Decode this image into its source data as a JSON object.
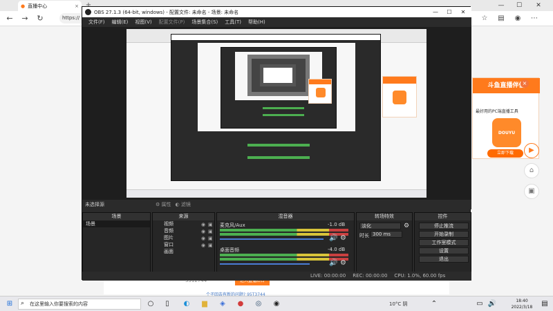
{
  "browser": {
    "tab_title": "直播中心",
    "address": "https://",
    "colors": {
      "accent": "#ff7a1c"
    }
  },
  "page": {
    "ad": {
      "title": "斗鱼直播伴侣",
      "desc": "最好用的PC端直播工具",
      "logo_text": "DOUYU",
      "download_button": "立即下载"
    },
    "bottom_number": "3312744",
    "bottom_button": "进入直播后台",
    "bottom_link": "个子回去有新的问题? 95T3744"
  },
  "obs": {
    "title": "OBS 27.1.3 (64-bit, windows) - 配置文件: 未命名 - 场景: 未命名",
    "menu": [
      "文件(F)",
      "编辑(E)",
      "视图(V)",
      "配置文件(P)",
      "场景集合(S)",
      "工具(T)",
      "帮助(H)"
    ],
    "status_left": "未选择源",
    "filter_labels": [
      "属性",
      "滤镜"
    ],
    "docks": {
      "scenes": {
        "title": "场景",
        "items": [
          "场景"
        ]
      },
      "sources": {
        "title": "来源",
        "items": [
          "视频",
          "音频",
          "图片",
          "窗口",
          "画面"
        ]
      },
      "mixer": {
        "title": "混音器",
        "tracks": [
          {
            "name": "麦克风/Aux",
            "db": "-1.0 dB"
          },
          {
            "name": "桌面音频",
            "db": "-4.0 dB"
          }
        ]
      },
      "transitions": {
        "title": "转场特效",
        "type": "淡化",
        "duration_label": "时长",
        "duration_value": "300 ms"
      },
      "controls": {
        "title": "控件",
        "buttons": [
          "停止推流",
          "开始录制",
          "工作室模式",
          "设置",
          "退出"
        ]
      }
    },
    "footer": {
      "live": "LIVE: 00:00:00",
      "rec": "REC: 00:00:00",
      "cpu": "CPU: 1.0%, 60.00 fps"
    }
  },
  "taskbar": {
    "search_placeholder": "在这里输入你要搜索的内容",
    "weather": "10°C 阴",
    "time": "18:40",
    "date": "2022/3/18"
  }
}
